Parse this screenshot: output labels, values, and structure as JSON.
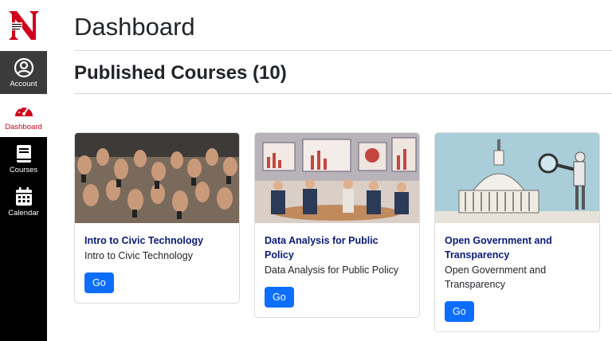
{
  "sidebar": {
    "logo_letter": "N",
    "items": [
      {
        "label": "Account",
        "icon": "account-circle-icon"
      },
      {
        "label": "Dashboard",
        "icon": "speedometer-icon"
      },
      {
        "label": "Courses",
        "icon": "book-icon"
      },
      {
        "label": "Calendar",
        "icon": "calendar-icon"
      }
    ],
    "active": "Dashboard",
    "colors": {
      "background": "#000000",
      "active_text": "#d0021b",
      "brand": "#d0021b"
    }
  },
  "page": {
    "title": "Dashboard",
    "section_title": "Published Courses (10)"
  },
  "courses": [
    {
      "title": "Intro to Civic Technology",
      "description": "Intro to Civic Technology",
      "button": "Go",
      "image": "crowd-holding-phones-illustration"
    },
    {
      "title": "Data Analysis for Public Policy",
      "description": "Data Analysis for Public Policy",
      "button": "Go",
      "image": "meeting-room-with-data-screens-illustration"
    },
    {
      "title": "Open Government and Transparency",
      "description": "Open Government and Transparency",
      "button": "Go",
      "image": "capitol-building-magnifier-illustration"
    }
  ],
  "colors": {
    "button": "#0d6efd",
    "card_title": "#0a1a7a"
  }
}
